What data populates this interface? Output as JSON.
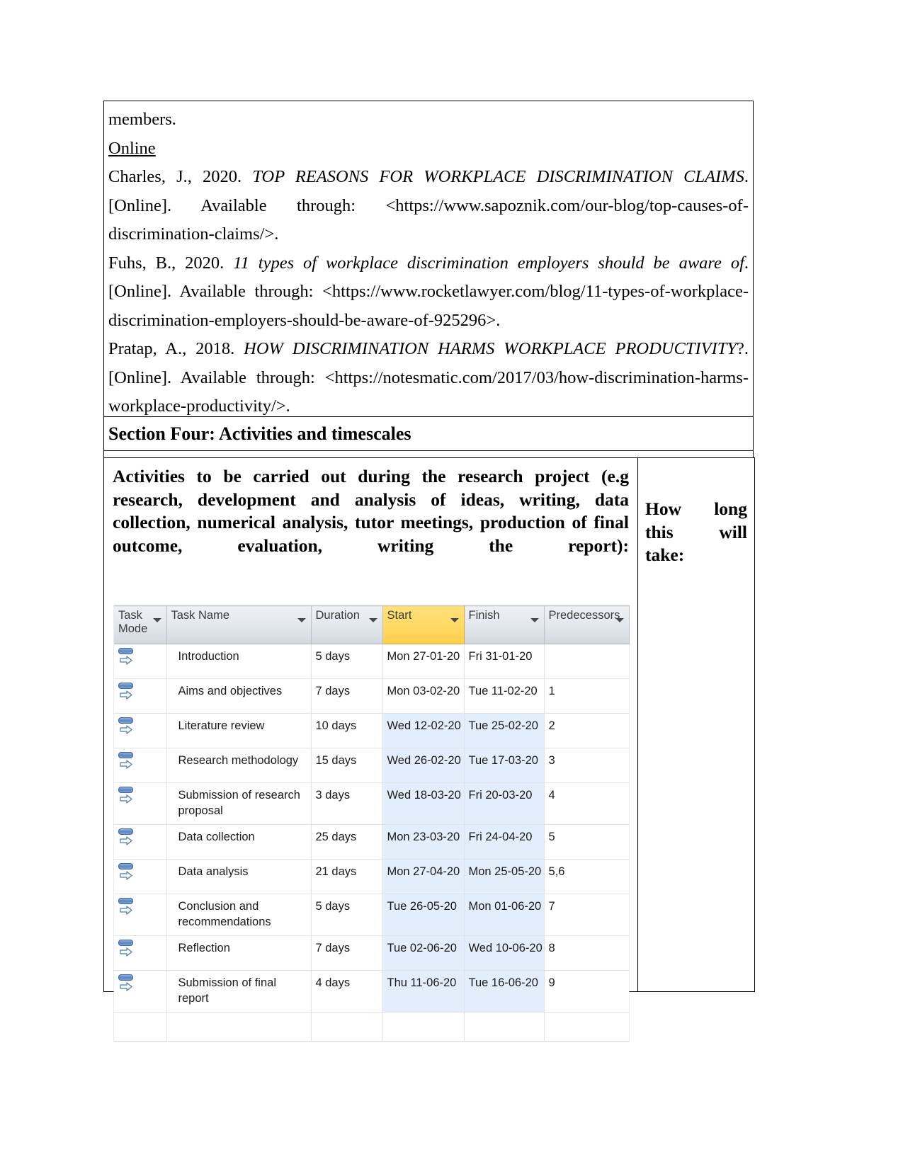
{
  "references": {
    "continuation_line": "members.",
    "online_heading": "Online",
    "entries": [
      {
        "author": "Charles, J., 2020. ",
        "title": "TOP REASONS FOR WORKPLACE DISCRIMINATION CLAIMS",
        "tail": ". [Online]. Available through: <https://www.sapoznik.com/our-blog/top-causes-of-discrimination-claims/>."
      },
      {
        "author": "Fuhs, B., 2020. ",
        "title": "11 types of workplace discrimination employers should be aware of",
        "tail": ". [Online]. Available through: <https://www.rocketlawyer.com/blog/11-types-of-workplace-discrimination-employers-should-be-aware-of-925296>."
      },
      {
        "author": "Pratap, A., 2018. ",
        "title": "HOW DISCRIMINATION HARMS WORKPLACE PRODUCTIVITY",
        "tail": "?. [Online]. Available through: <https://notesmatic.com/2017/03/how-discrimination-harms-workplace-productivity/>."
      }
    ]
  },
  "section": {
    "heading": "Section Four: Activities and timescales"
  },
  "activities": {
    "prompt": "Activities to be carried out during the research project (e.g research, development and analysis of ideas, writing, data collection, numerical analysis, tutor meetings, production of final outcome, evaluation, writing the report):",
    "duration_header": "How long this will take:"
  },
  "project_grid": {
    "columns": [
      {
        "id": "task_mode",
        "label": "Task Mode",
        "highlight": false,
        "has_filter": true
      },
      {
        "id": "task_name",
        "label": "Task Name",
        "highlight": false,
        "has_filter": true
      },
      {
        "id": "duration",
        "label": "Duration",
        "highlight": false,
        "has_filter": true
      },
      {
        "id": "start",
        "label": "Start",
        "highlight": true,
        "has_filter": true
      },
      {
        "id": "finish",
        "label": "Finish",
        "highlight": false,
        "has_filter": true
      },
      {
        "id": "predecessors",
        "label": "Predecessors",
        "highlight": false,
        "has_filter": true
      }
    ],
    "highlight_color": "#ffd964",
    "date_cell_color": "#e3eefc",
    "rows": [
      {
        "task_mode_icon": "auto-scheduled-icon",
        "task_name": "Introduction",
        "duration": "5 days",
        "start": "Mon 27-01-20",
        "finish": "Fri 31-01-20",
        "predecessors": "",
        "date_highlight": false
      },
      {
        "task_mode_icon": "auto-scheduled-icon",
        "task_name": "Aims and objectives",
        "duration": "7 days",
        "start": "Mon 03-02-20",
        "finish": "Tue 11-02-20",
        "predecessors": "1",
        "date_highlight": false
      },
      {
        "task_mode_icon": "auto-scheduled-icon",
        "task_name": "Literature review",
        "duration": "10 days",
        "start": "Wed 12-02-20",
        "finish": "Tue 25-02-20",
        "predecessors": "2",
        "date_highlight": true
      },
      {
        "task_mode_icon": "auto-scheduled-icon",
        "task_name": "Research methodology",
        "duration": "15 days",
        "start": "Wed 26-02-20",
        "finish": "Tue 17-03-20",
        "predecessors": "3",
        "date_highlight": true
      },
      {
        "task_mode_icon": "auto-scheduled-icon",
        "task_name": "Submission of research proposal",
        "duration": "3 days",
        "start": "Wed 18-03-20",
        "finish": "Fri 20-03-20",
        "predecessors": "4",
        "date_highlight": true
      },
      {
        "task_mode_icon": "auto-scheduled-icon",
        "task_name": "Data collection",
        "duration": "25 days",
        "start": "Mon 23-03-20",
        "finish": "Fri 24-04-20",
        "predecessors": "5",
        "date_highlight": true
      },
      {
        "task_mode_icon": "auto-scheduled-icon",
        "task_name": "Data analysis",
        "duration": "21 days",
        "start": "Mon 27-04-20",
        "finish": "Mon 25-05-20",
        "predecessors": "5,6",
        "date_highlight": true
      },
      {
        "task_mode_icon": "auto-scheduled-icon",
        "task_name": "Conclusion and recommendations",
        "duration": "5 days",
        "start": "Tue 26-05-20",
        "finish": "Mon 01-06-20",
        "predecessors": "7",
        "date_highlight": true
      },
      {
        "task_mode_icon": "auto-scheduled-icon",
        "task_name": "Reflection",
        "duration": "7 days",
        "start": "Tue 02-06-20",
        "finish": "Wed 10-06-20",
        "predecessors": "8",
        "date_highlight": true
      },
      {
        "task_mode_icon": "auto-scheduled-icon",
        "task_name": "Submission of final report",
        "duration": "4 days",
        "start": "Thu 11-06-20",
        "finish": "Tue 16-06-20",
        "predecessors": "9",
        "date_highlight": true
      }
    ]
  }
}
